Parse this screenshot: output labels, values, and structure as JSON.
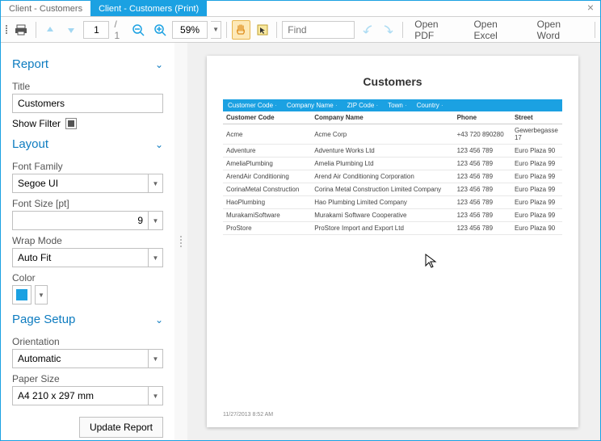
{
  "tabs": {
    "inactive": "Client - Customers",
    "active": "Client - Customers (Print)"
  },
  "toolbar": {
    "page_current": "1",
    "page_total": "/ 1",
    "zoom": "59%",
    "find_placeholder": "Find",
    "open_pdf": "Open PDF",
    "open_excel": "Open Excel",
    "open_word": "Open Word"
  },
  "sidebar": {
    "report": {
      "header": "Report",
      "title_label": "Title",
      "title_value": "Customers",
      "show_filter_label": "Show Filter"
    },
    "layout": {
      "header": "Layout",
      "font_family_label": "Font Family",
      "font_family_value": "Segoe UI",
      "font_size_label": "Font Size [pt]",
      "font_size_value": "9",
      "wrap_label": "Wrap Mode",
      "wrap_value": "Auto Fit",
      "color_label": "Color",
      "color_value": "#1ba1e2"
    },
    "page_setup": {
      "header": "Page Setup",
      "orientation_label": "Orientation",
      "orientation_value": "Automatic",
      "paper_label": "Paper Size",
      "paper_value": "A4 210 x 297 mm"
    },
    "update_btn": "Update Report"
  },
  "document": {
    "title": "Customers",
    "filter_fields": [
      "Customer Code",
      "Company Name",
      "ZIP Code",
      "Town",
      "Country"
    ],
    "columns": [
      "Customer Code",
      "Company Name",
      "Phone",
      "Street"
    ],
    "rows": [
      {
        "code": "Acme",
        "company": "Acme Corp",
        "phone": "+43 720 890280",
        "street": "Gewerbegasse 17"
      },
      {
        "code": "Adventure",
        "company": "Adventure Works Ltd",
        "phone": "123 456 789",
        "street": "Euro Plaza 90"
      },
      {
        "code": "AmeliaPlumbing",
        "company": "Amelia Plumbing Ltd",
        "phone": "123 456 789",
        "street": "Euro Plaza 99"
      },
      {
        "code": "ArendAir Conditioning",
        "company": "Arend Air Conditioning Corporation",
        "phone": "123 456 789",
        "street": "Euro Plaza 99"
      },
      {
        "code": "CorinaMetal Construction",
        "company": "Corina Metal Construction Limited Company",
        "phone": "123 456 789",
        "street": "Euro Plaza 99"
      },
      {
        "code": "HaoPlumbing",
        "company": "Hao Plumbing Limited Company",
        "phone": "123 456 789",
        "street": "Euro Plaza 99"
      },
      {
        "code": "MurakamiSoftware",
        "company": "Murakami Software Cooperative",
        "phone": "123 456 789",
        "street": "Euro Plaza 99"
      },
      {
        "code": "ProStore",
        "company": "ProStore Import and Export Ltd",
        "phone": "123 456 789",
        "street": "Euro Plaza 90"
      }
    ],
    "footer": "11/27/2013 8:52 AM"
  }
}
